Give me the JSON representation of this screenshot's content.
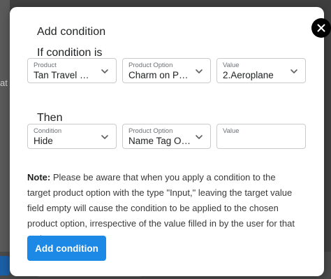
{
  "background": {
    "fragment_text": "at"
  },
  "modal": {
    "title": "Add condition",
    "if_heading": "If condition is",
    "then_heading": "Then",
    "close_icon": "close-icon",
    "if_row": [
      {
        "label": "Product",
        "value": "Tan Travel Wa..."
      },
      {
        "label": "Product Option",
        "value": "Charm on Pro..."
      },
      {
        "label": "Value",
        "value": "2.Aeroplane"
      }
    ],
    "then_row": [
      {
        "label": "Condition",
        "value": "Hide"
      },
      {
        "label": "Product Option",
        "value": "Name Tag On..."
      },
      {
        "label": "Value",
        "value": ""
      }
    ],
    "note_label": "Note:",
    "note_text": " Please be aware that when you apply a condition to the target product option with the type \"Input,\" leaving the target value field empty will cause the condition to be applied to the chosen product option, irrespective of the value filled in by the user for that option.",
    "submit_label": "Add condition"
  },
  "colors": {
    "primary": "#1c89e6",
    "close_bg": "#000000",
    "overlay": "#3f3f3f"
  }
}
